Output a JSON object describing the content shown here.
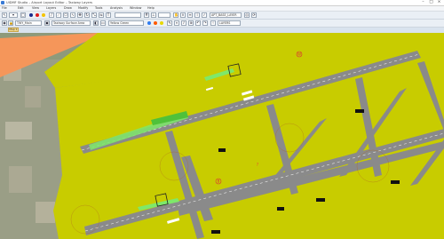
{
  "window": {
    "title": "UIDMF Studio – Airport Layout Editor – Taxiway Layers"
  },
  "menu": [
    "File",
    "Edit",
    "View",
    "Layers",
    "Draw",
    "Modify",
    "Tools",
    "Analysis",
    "Window",
    "Help"
  ],
  "toolbar1": {
    "layer_field": "APT_BASE_LAYER",
    "zoom_field": "",
    "text_tool_label": "T"
  },
  "toolbar2": {
    "layer_select": "TWY_Main",
    "style_select": "Taxiway Surface Area",
    "color_select": "Yellow Green",
    "extra_field": "LAYERS"
  },
  "tab": {
    "label": "Map 1"
  },
  "map": {
    "colors": {
      "pavement": "#c8cc00",
      "taxiway": "#808080",
      "orange_strip": "#f5965a",
      "green_guide": "#7ee86a",
      "imagery": "#8e9a7b"
    },
    "marker_labels": [
      "W",
      "B",
      "?"
    ]
  }
}
